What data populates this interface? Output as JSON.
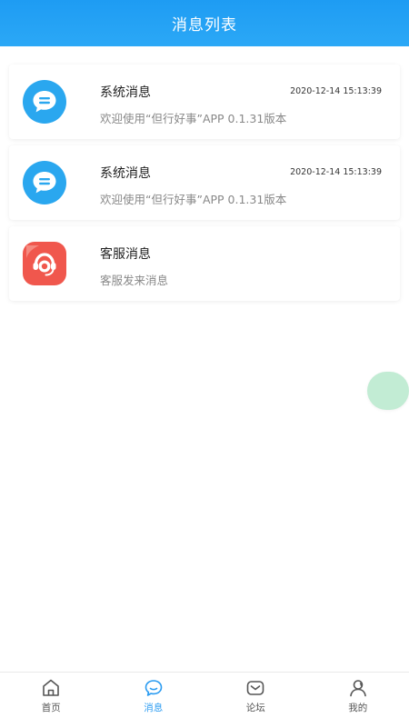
{
  "header": {
    "title": "消息列表"
  },
  "messages": [
    {
      "title": "系统消息",
      "time": "2020-12-14 15:13:39",
      "preview": "欢迎使用“但行好事”APP 0.1.31版本",
      "icon": "chat-bubble-icon"
    },
    {
      "title": "系统消息",
      "time": "2020-12-14 15:13:39",
      "preview": "欢迎使用“但行好事”APP 0.1.31版本",
      "icon": "chat-bubble-icon"
    },
    {
      "title": "客服消息",
      "time": "",
      "preview": "客服发来消息",
      "icon": "customer-service-icon"
    }
  ],
  "tabs": [
    {
      "label": "首页",
      "icon": "home-icon",
      "active": false
    },
    {
      "label": "消息",
      "icon": "message-icon",
      "active": true
    },
    {
      "label": "论坛",
      "icon": "mail-icon",
      "active": false
    },
    {
      "label": "我的",
      "icon": "user-icon",
      "active": false
    }
  ],
  "colors": {
    "header": "#1e9cf3",
    "accent": "#2a9bf1",
    "system_icon": "#2aa7ef",
    "service_icon": "#f0574d",
    "float_bubble": "#c2ecd4"
  }
}
